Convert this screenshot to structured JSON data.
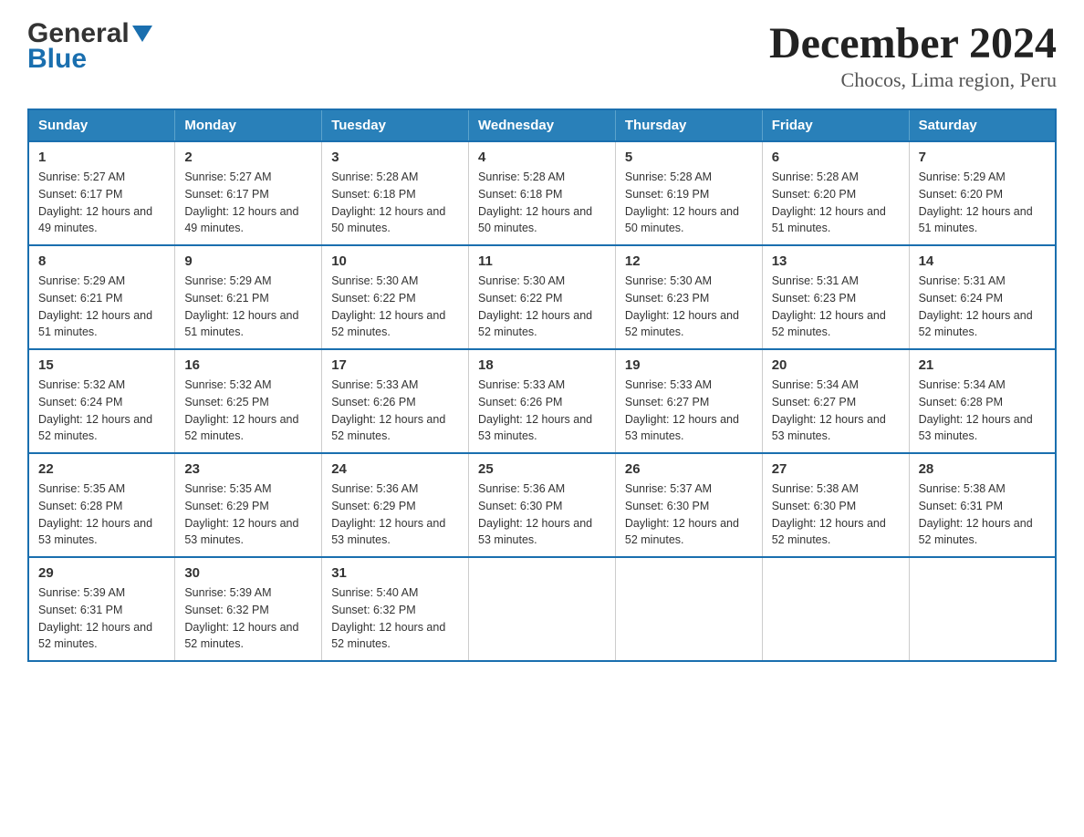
{
  "header": {
    "logo_general": "General",
    "logo_blue": "Blue",
    "title": "December 2024",
    "subtitle": "Chocos, Lima region, Peru"
  },
  "calendar": {
    "days_of_week": [
      "Sunday",
      "Monday",
      "Tuesday",
      "Wednesday",
      "Thursday",
      "Friday",
      "Saturday"
    ],
    "weeks": [
      [
        {
          "day": "1",
          "sunrise": "5:27 AM",
          "sunset": "6:17 PM",
          "daylight": "12 hours and 49 minutes."
        },
        {
          "day": "2",
          "sunrise": "5:27 AM",
          "sunset": "6:17 PM",
          "daylight": "12 hours and 49 minutes."
        },
        {
          "day": "3",
          "sunrise": "5:28 AM",
          "sunset": "6:18 PM",
          "daylight": "12 hours and 50 minutes."
        },
        {
          "day": "4",
          "sunrise": "5:28 AM",
          "sunset": "6:18 PM",
          "daylight": "12 hours and 50 minutes."
        },
        {
          "day": "5",
          "sunrise": "5:28 AM",
          "sunset": "6:19 PM",
          "daylight": "12 hours and 50 minutes."
        },
        {
          "day": "6",
          "sunrise": "5:28 AM",
          "sunset": "6:20 PM",
          "daylight": "12 hours and 51 minutes."
        },
        {
          "day": "7",
          "sunrise": "5:29 AM",
          "sunset": "6:20 PM",
          "daylight": "12 hours and 51 minutes."
        }
      ],
      [
        {
          "day": "8",
          "sunrise": "5:29 AM",
          "sunset": "6:21 PM",
          "daylight": "12 hours and 51 minutes."
        },
        {
          "day": "9",
          "sunrise": "5:29 AM",
          "sunset": "6:21 PM",
          "daylight": "12 hours and 51 minutes."
        },
        {
          "day": "10",
          "sunrise": "5:30 AM",
          "sunset": "6:22 PM",
          "daylight": "12 hours and 52 minutes."
        },
        {
          "day": "11",
          "sunrise": "5:30 AM",
          "sunset": "6:22 PM",
          "daylight": "12 hours and 52 minutes."
        },
        {
          "day": "12",
          "sunrise": "5:30 AM",
          "sunset": "6:23 PM",
          "daylight": "12 hours and 52 minutes."
        },
        {
          "day": "13",
          "sunrise": "5:31 AM",
          "sunset": "6:23 PM",
          "daylight": "12 hours and 52 minutes."
        },
        {
          "day": "14",
          "sunrise": "5:31 AM",
          "sunset": "6:24 PM",
          "daylight": "12 hours and 52 minutes."
        }
      ],
      [
        {
          "day": "15",
          "sunrise": "5:32 AM",
          "sunset": "6:24 PM",
          "daylight": "12 hours and 52 minutes."
        },
        {
          "day": "16",
          "sunrise": "5:32 AM",
          "sunset": "6:25 PM",
          "daylight": "12 hours and 52 minutes."
        },
        {
          "day": "17",
          "sunrise": "5:33 AM",
          "sunset": "6:26 PM",
          "daylight": "12 hours and 52 minutes."
        },
        {
          "day": "18",
          "sunrise": "5:33 AM",
          "sunset": "6:26 PM",
          "daylight": "12 hours and 53 minutes."
        },
        {
          "day": "19",
          "sunrise": "5:33 AM",
          "sunset": "6:27 PM",
          "daylight": "12 hours and 53 minutes."
        },
        {
          "day": "20",
          "sunrise": "5:34 AM",
          "sunset": "6:27 PM",
          "daylight": "12 hours and 53 minutes."
        },
        {
          "day": "21",
          "sunrise": "5:34 AM",
          "sunset": "6:28 PM",
          "daylight": "12 hours and 53 minutes."
        }
      ],
      [
        {
          "day": "22",
          "sunrise": "5:35 AM",
          "sunset": "6:28 PM",
          "daylight": "12 hours and 53 minutes."
        },
        {
          "day": "23",
          "sunrise": "5:35 AM",
          "sunset": "6:29 PM",
          "daylight": "12 hours and 53 minutes."
        },
        {
          "day": "24",
          "sunrise": "5:36 AM",
          "sunset": "6:29 PM",
          "daylight": "12 hours and 53 minutes."
        },
        {
          "day": "25",
          "sunrise": "5:36 AM",
          "sunset": "6:30 PM",
          "daylight": "12 hours and 53 minutes."
        },
        {
          "day": "26",
          "sunrise": "5:37 AM",
          "sunset": "6:30 PM",
          "daylight": "12 hours and 52 minutes."
        },
        {
          "day": "27",
          "sunrise": "5:38 AM",
          "sunset": "6:30 PM",
          "daylight": "12 hours and 52 minutes."
        },
        {
          "day": "28",
          "sunrise": "5:38 AM",
          "sunset": "6:31 PM",
          "daylight": "12 hours and 52 minutes."
        }
      ],
      [
        {
          "day": "29",
          "sunrise": "5:39 AM",
          "sunset": "6:31 PM",
          "daylight": "12 hours and 52 minutes."
        },
        {
          "day": "30",
          "sunrise": "5:39 AM",
          "sunset": "6:32 PM",
          "daylight": "12 hours and 52 minutes."
        },
        {
          "day": "31",
          "sunrise": "5:40 AM",
          "sunset": "6:32 PM",
          "daylight": "12 hours and 52 minutes."
        },
        null,
        null,
        null,
        null
      ]
    ]
  }
}
